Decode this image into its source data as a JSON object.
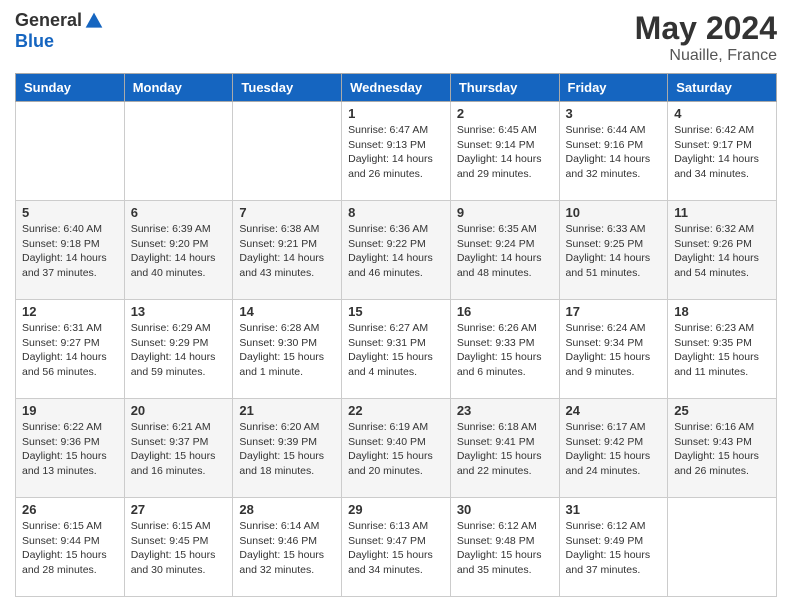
{
  "header": {
    "logo_general": "General",
    "logo_blue": "Blue",
    "main_title": "May 2024",
    "subtitle": "Nuaille, France"
  },
  "days_of_week": [
    "Sunday",
    "Monday",
    "Tuesday",
    "Wednesday",
    "Thursday",
    "Friday",
    "Saturday"
  ],
  "weeks": [
    [
      {
        "day": "",
        "info": ""
      },
      {
        "day": "",
        "info": ""
      },
      {
        "day": "",
        "info": ""
      },
      {
        "day": "1",
        "info": "Sunrise: 6:47 AM\nSunset: 9:13 PM\nDaylight: 14 hours\nand 26 minutes."
      },
      {
        "day": "2",
        "info": "Sunrise: 6:45 AM\nSunset: 9:14 PM\nDaylight: 14 hours\nand 29 minutes."
      },
      {
        "day": "3",
        "info": "Sunrise: 6:44 AM\nSunset: 9:16 PM\nDaylight: 14 hours\nand 32 minutes."
      },
      {
        "day": "4",
        "info": "Sunrise: 6:42 AM\nSunset: 9:17 PM\nDaylight: 14 hours\nand 34 minutes."
      }
    ],
    [
      {
        "day": "5",
        "info": "Sunrise: 6:40 AM\nSunset: 9:18 PM\nDaylight: 14 hours\nand 37 minutes."
      },
      {
        "day": "6",
        "info": "Sunrise: 6:39 AM\nSunset: 9:20 PM\nDaylight: 14 hours\nand 40 minutes."
      },
      {
        "day": "7",
        "info": "Sunrise: 6:38 AM\nSunset: 9:21 PM\nDaylight: 14 hours\nand 43 minutes."
      },
      {
        "day": "8",
        "info": "Sunrise: 6:36 AM\nSunset: 9:22 PM\nDaylight: 14 hours\nand 46 minutes."
      },
      {
        "day": "9",
        "info": "Sunrise: 6:35 AM\nSunset: 9:24 PM\nDaylight: 14 hours\nand 48 minutes."
      },
      {
        "day": "10",
        "info": "Sunrise: 6:33 AM\nSunset: 9:25 PM\nDaylight: 14 hours\nand 51 minutes."
      },
      {
        "day": "11",
        "info": "Sunrise: 6:32 AM\nSunset: 9:26 PM\nDaylight: 14 hours\nand 54 minutes."
      }
    ],
    [
      {
        "day": "12",
        "info": "Sunrise: 6:31 AM\nSunset: 9:27 PM\nDaylight: 14 hours\nand 56 minutes."
      },
      {
        "day": "13",
        "info": "Sunrise: 6:29 AM\nSunset: 9:29 PM\nDaylight: 14 hours\nand 59 minutes."
      },
      {
        "day": "14",
        "info": "Sunrise: 6:28 AM\nSunset: 9:30 PM\nDaylight: 15 hours\nand 1 minute."
      },
      {
        "day": "15",
        "info": "Sunrise: 6:27 AM\nSunset: 9:31 PM\nDaylight: 15 hours\nand 4 minutes."
      },
      {
        "day": "16",
        "info": "Sunrise: 6:26 AM\nSunset: 9:33 PM\nDaylight: 15 hours\nand 6 minutes."
      },
      {
        "day": "17",
        "info": "Sunrise: 6:24 AM\nSunset: 9:34 PM\nDaylight: 15 hours\nand 9 minutes."
      },
      {
        "day": "18",
        "info": "Sunrise: 6:23 AM\nSunset: 9:35 PM\nDaylight: 15 hours\nand 11 minutes."
      }
    ],
    [
      {
        "day": "19",
        "info": "Sunrise: 6:22 AM\nSunset: 9:36 PM\nDaylight: 15 hours\nand 13 minutes."
      },
      {
        "day": "20",
        "info": "Sunrise: 6:21 AM\nSunset: 9:37 PM\nDaylight: 15 hours\nand 16 minutes."
      },
      {
        "day": "21",
        "info": "Sunrise: 6:20 AM\nSunset: 9:39 PM\nDaylight: 15 hours\nand 18 minutes."
      },
      {
        "day": "22",
        "info": "Sunrise: 6:19 AM\nSunset: 9:40 PM\nDaylight: 15 hours\nand 20 minutes."
      },
      {
        "day": "23",
        "info": "Sunrise: 6:18 AM\nSunset: 9:41 PM\nDaylight: 15 hours\nand 22 minutes."
      },
      {
        "day": "24",
        "info": "Sunrise: 6:17 AM\nSunset: 9:42 PM\nDaylight: 15 hours\nand 24 minutes."
      },
      {
        "day": "25",
        "info": "Sunrise: 6:16 AM\nSunset: 9:43 PM\nDaylight: 15 hours\nand 26 minutes."
      }
    ],
    [
      {
        "day": "26",
        "info": "Sunrise: 6:15 AM\nSunset: 9:44 PM\nDaylight: 15 hours\nand 28 minutes."
      },
      {
        "day": "27",
        "info": "Sunrise: 6:15 AM\nSunset: 9:45 PM\nDaylight: 15 hours\nand 30 minutes."
      },
      {
        "day": "28",
        "info": "Sunrise: 6:14 AM\nSunset: 9:46 PM\nDaylight: 15 hours\nand 32 minutes."
      },
      {
        "day": "29",
        "info": "Sunrise: 6:13 AM\nSunset: 9:47 PM\nDaylight: 15 hours\nand 34 minutes."
      },
      {
        "day": "30",
        "info": "Sunrise: 6:12 AM\nSunset: 9:48 PM\nDaylight: 15 hours\nand 35 minutes."
      },
      {
        "day": "31",
        "info": "Sunrise: 6:12 AM\nSunset: 9:49 PM\nDaylight: 15 hours\nand 37 minutes."
      },
      {
        "day": "",
        "info": ""
      }
    ]
  ]
}
